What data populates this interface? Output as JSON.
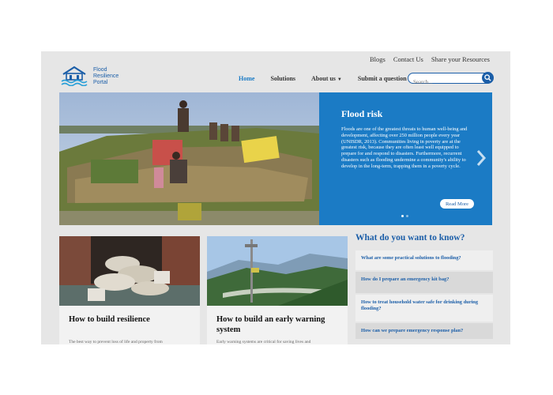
{
  "util_links": [
    "Blogs",
    "Contact Us",
    "Share your Resources"
  ],
  "logo": {
    "line1": "Flood",
    "line2": "Resilience",
    "line3": "Portal"
  },
  "nav": {
    "home": "Home",
    "solutions": "Solutions",
    "about": "About us",
    "submit": "Submit a question"
  },
  "search": {
    "placeholder": "Search..."
  },
  "hero": {
    "title": "Flood risk",
    "body": "Floods are one of the greatest threats to human well-being and development, affecting over 250 million people every year (UNISDR, 2013). Communities living in poverty are at the greatest risk, because they are often least well equipped to prepare for and respond to disasters. Furthermore, recurrent disasters such as flooding undermine a community's ability to develop in the long-term, trapping them in a poverty cycle.",
    "read_more": "Read More"
  },
  "cards": [
    {
      "title": "How to build resilience",
      "snippet": "The best way to prevent loss of life and property from"
    },
    {
      "title": "How to build an early warning system",
      "snippet": "Early warning systems are critical for saving lives and"
    }
  ],
  "faq": {
    "heading": "What do you want to know?",
    "items": [
      "What are some practical solutions to flooding?",
      "How do I prepare an emergency kit bag?",
      "How to treat household water safe for drinking during flooding?",
      "How can we prepare emergency response plan?"
    ]
  },
  "colors": {
    "brand_blue": "#1b5ea8",
    "accent_blue": "#1b7bc5",
    "page_bg": "#e6e6e6"
  }
}
